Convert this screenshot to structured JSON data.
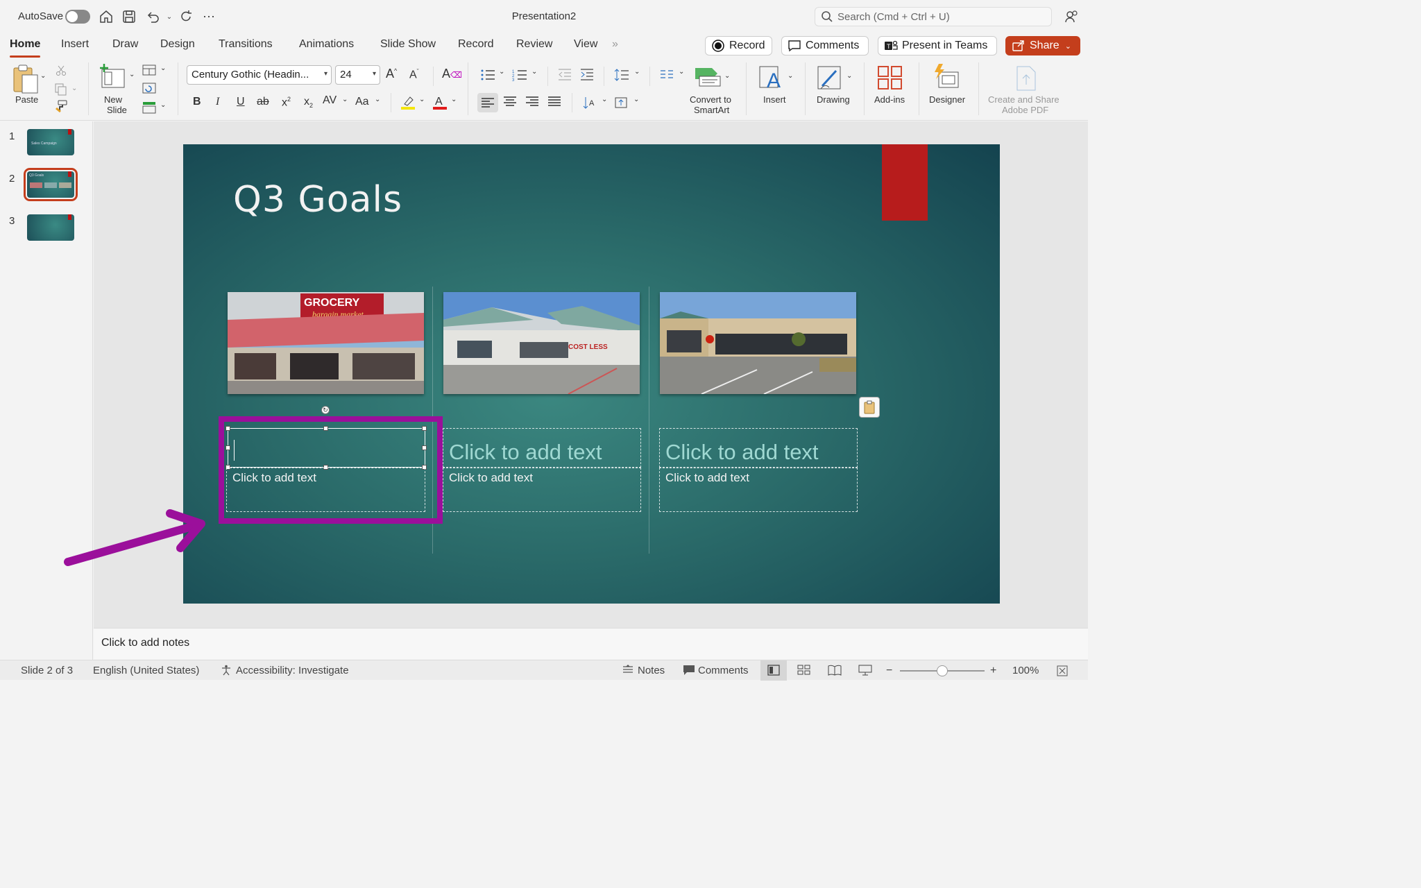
{
  "titlebar": {
    "autosave": "AutoSave",
    "title": "Presentation2",
    "search_placeholder": "Search (Cmd + Ctrl + U)"
  },
  "tabs": [
    "Home",
    "Insert",
    "Draw",
    "Design",
    "Transitions",
    "Animations",
    "Slide Show",
    "Record",
    "Review",
    "View"
  ],
  "tab_more": "»",
  "actions": {
    "record": "Record",
    "comments": "Comments",
    "present_teams": "Present in Teams",
    "share": "Share"
  },
  "ribbon": {
    "paste": "Paste",
    "new_slide_1": "New",
    "new_slide_2": "Slide",
    "font_name": "Century Gothic (Headin...",
    "font_size": "24",
    "convert_1": "Convert to",
    "convert_2": "SmartArt",
    "insert": "Insert",
    "drawing": "Drawing",
    "addins": "Add-ins",
    "designer": "Designer",
    "adobe_1": "Create and Share",
    "adobe_2": "Adobe PDF"
  },
  "thumbnails": [
    {
      "num": "1",
      "label": "Sales Campaign"
    },
    {
      "num": "2",
      "label": "Q3 Goals"
    },
    {
      "num": "3",
      "label": ""
    }
  ],
  "slide": {
    "title": "Q3 Goals",
    "placeholder_heading": "Click to add text",
    "placeholder_body": "Click to add text"
  },
  "notes": "Click to add notes",
  "statusbar": {
    "slide": "Slide 2 of 3",
    "language": "English (United States)",
    "accessibility": "Accessibility: Investigate",
    "notes": "Notes",
    "comments": "Comments",
    "zoom": "100%"
  },
  "colors": {
    "accent": "#c43e1c",
    "annotation": "#9b0f9b",
    "slide_red": "#b71c1c"
  }
}
